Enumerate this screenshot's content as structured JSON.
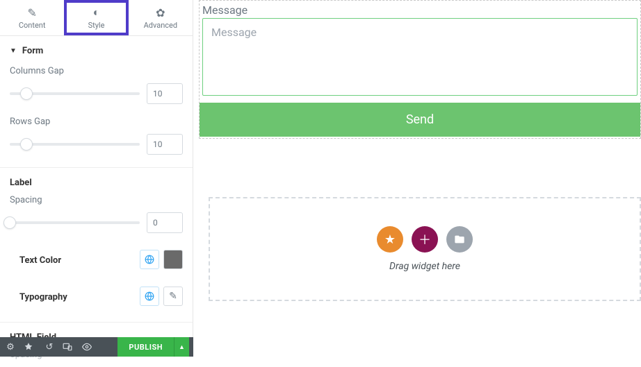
{
  "tabs": {
    "content": "Content",
    "style": "Style",
    "advanced": "Advanced"
  },
  "form": {
    "section_title": "Form",
    "columns_gap": {
      "label": "Columns Gap",
      "value": "10",
      "thumb_pct": 13
    },
    "rows_gap": {
      "label": "Rows Gap",
      "value": "10",
      "thumb_pct": 13
    }
  },
  "label": {
    "section_title": "Label",
    "spacing": {
      "label": "Spacing",
      "value": "0",
      "thumb_pct": 0
    },
    "text_color": {
      "label": "Text Color"
    },
    "typography": {
      "label": "Typography"
    }
  },
  "html_field": {
    "section_title": "HTML Field",
    "spacing_label": "Spacing"
  },
  "footer": {
    "publish": "PUBLISH"
  },
  "canvas": {
    "field_label": "Message",
    "placeholder": "Message",
    "send": "Send",
    "drop_text": "Drag widget here"
  }
}
